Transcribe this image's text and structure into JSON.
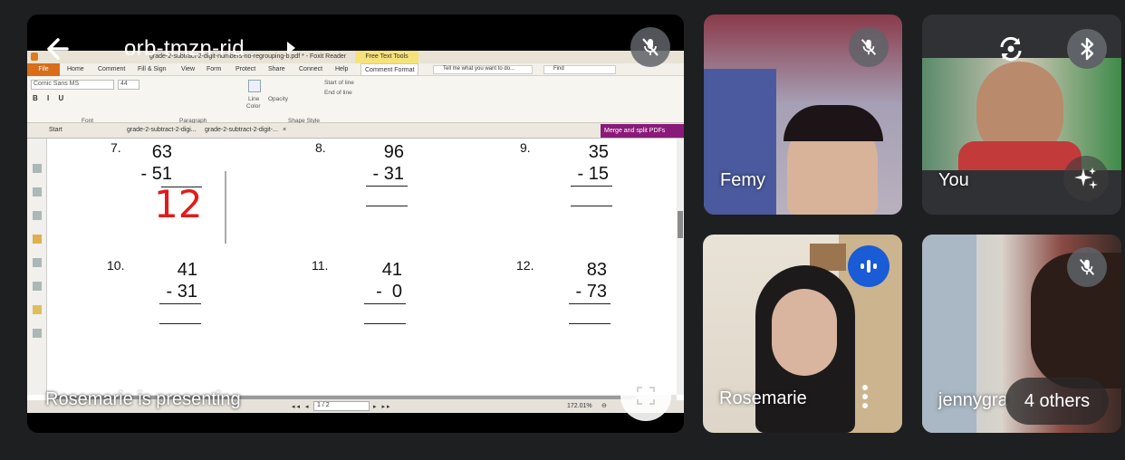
{
  "meeting": {
    "code": "orb-tmzn-rid",
    "presenting_text": "Rosemarie is presenting"
  },
  "icons": {
    "back": "arrow-left-icon",
    "caret": "chevron-right-icon",
    "mic_off": "mic-off-icon",
    "fullscreen": "fullscreen-icon",
    "switch_camera": "switch-camera-icon",
    "bluetooth": "bluetooth-icon",
    "effects": "sparkle-effects-icon",
    "speaking": "audio-level-icon",
    "more": "more-vertical-icon"
  },
  "app": {
    "title_bar": "grade-2-subtract-2-digit-numbers-no-regrouping-b.pdf * - Foxit Reader",
    "free_text_tools": "Free Text Tools",
    "menu": [
      "File",
      "Home",
      "Comment",
      "Fill & Sign",
      "View",
      "Form",
      "Protect",
      "Share",
      "Connect",
      "Help",
      "Comment Format"
    ],
    "tell_me": "Tell me what you want to do...",
    "find": "Find",
    "font_name": "Comic Sans MS",
    "font_size": "44",
    "ribbon_groups": [
      "Font",
      "Paragraph",
      "Shape Style"
    ],
    "line_label": "Line",
    "color_label": "Color",
    "opacity_label": "Opacity",
    "start_of_line": "Start of line",
    "end_of_line": "End of line",
    "doc_tabs": [
      "Start",
      "grade-2-subtract-2-digi...",
      "grade-2-subtract-2-digit-..."
    ],
    "merge_button": "Merge and split PDFs",
    "page_indicator": "1 / 2",
    "zoom": "172.01%"
  },
  "worksheet": {
    "problems": [
      {
        "n": "7.",
        "top": "63",
        "bottom": "- 51",
        "answer": "12"
      },
      {
        "n": "8.",
        "top": "96",
        "bottom": "- 31",
        "answer": ""
      },
      {
        "n": "9.",
        "top": "35",
        "bottom": "- 15",
        "answer": ""
      },
      {
        "n": "10.",
        "top": "41",
        "bottom": "- 31",
        "answer": ""
      },
      {
        "n": "11.",
        "top": "41",
        "bottom": "-  0",
        "answer": ""
      },
      {
        "n": "12.",
        "top": "83",
        "bottom": "- 73",
        "answer": ""
      }
    ]
  },
  "participants": [
    {
      "name": "Femy"
    },
    {
      "name": "You"
    },
    {
      "name": "Rosemarie"
    },
    {
      "name": "jennygra"
    }
  ],
  "others_label": "4 others",
  "colors": {
    "background": "#202124",
    "answer_red": "#e11b1b",
    "speaking_blue": "#1a5bd6",
    "mic_chip": "#5f6368"
  }
}
